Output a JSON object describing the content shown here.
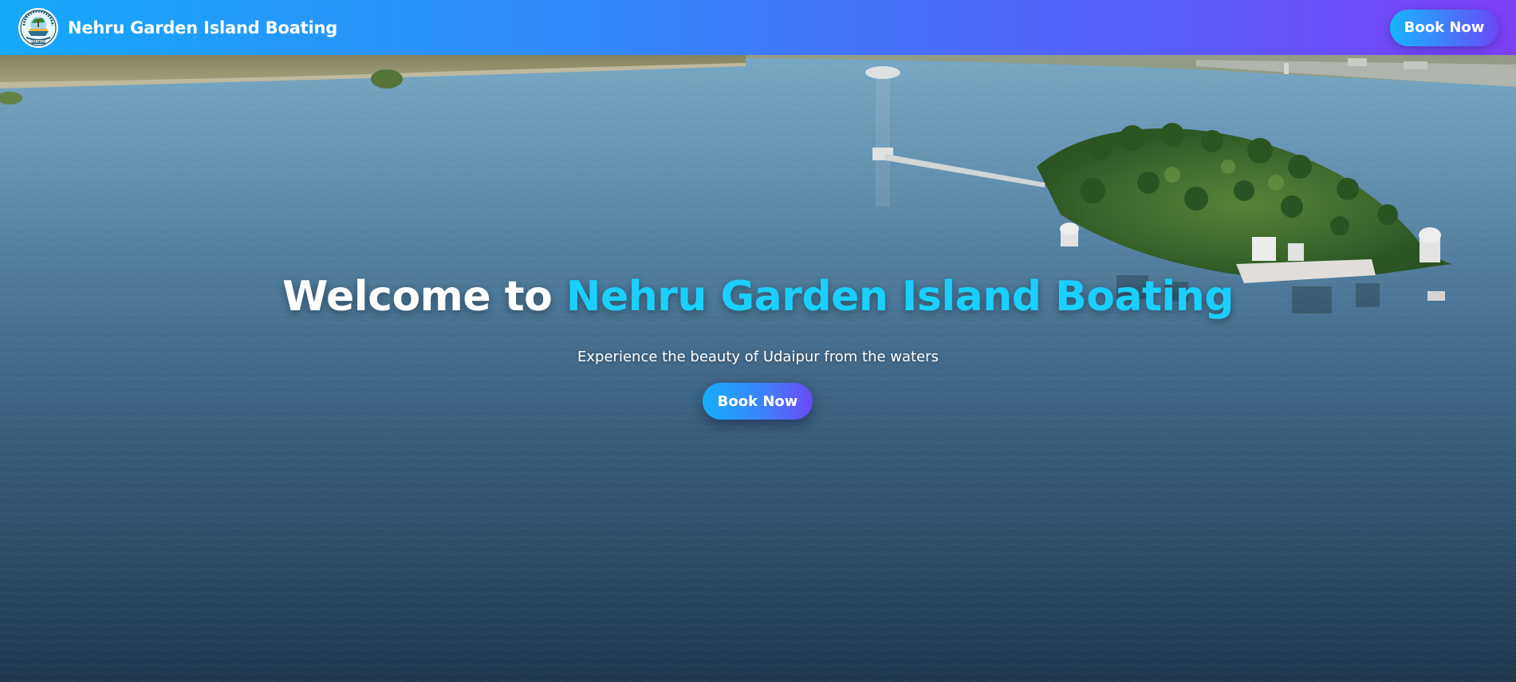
{
  "header": {
    "brand_name": "Nehru Garden Island Boating",
    "logo_icon": "boat-logo-icon",
    "book_now_label": "Book Now"
  },
  "hero": {
    "title_prefix": "Welcome to ",
    "title_highlight": "Nehru Garden Island Boating",
    "subtitle": "Experience the beauty of Udaipur from the waters",
    "book_now_label": "Book Now",
    "background": "aerial-lake-island-photo"
  },
  "colors": {
    "nav_gradient_start": "#16a8fb",
    "nav_gradient_end": "#7d3ff6",
    "title_highlight": "#1ad0ff",
    "text": "#ffffff"
  }
}
